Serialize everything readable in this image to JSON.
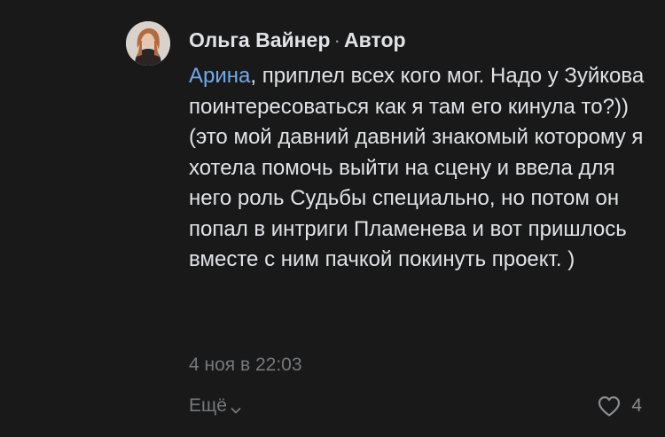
{
  "comment": {
    "author_name": "Ольга Вайнер",
    "separator": "·",
    "author_badge": "Автор",
    "mention": "Арина",
    "text": ", приплел всех кого мог. Надо у Зуйкова поинтересоваться как я там его кинула то?)) (это мой давний давний знакомый которому я хотела помочь выйти на сцену и ввела для него роль Судьбы специально, но потом он попал в интриги Пламенева и вот пришлось вместе с ним пачкой покинуть проект. )",
    "timestamp": "4 ноя в 22:03",
    "more_label": "Ещё",
    "like_count": "4"
  },
  "colors": {
    "background": "#19191a",
    "text": "#e1e3e6",
    "mention": "#71aaeb",
    "secondary": "#76787a"
  },
  "icons": {
    "avatar": "avatar",
    "more": "chevron-down-icon",
    "like": "heart-icon"
  }
}
